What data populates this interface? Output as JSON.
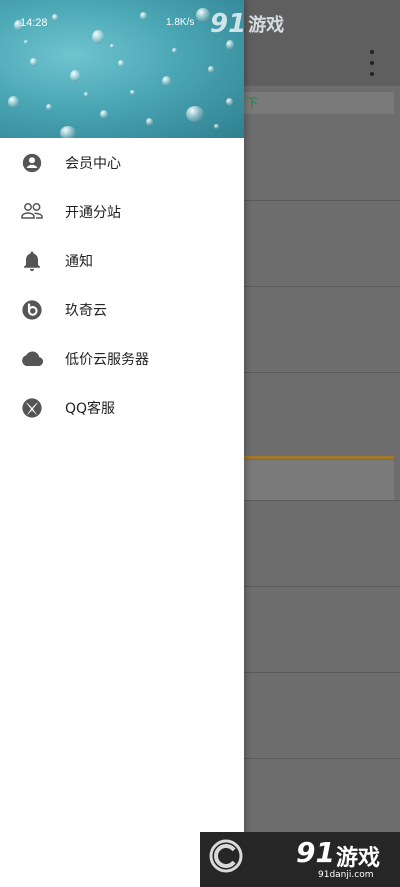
{
  "status_bar": {
    "time": "14:28",
    "net_speed": "1.8K/s"
  },
  "drawer": {
    "menu": [
      {
        "label": "会员中心",
        "icon": "account-circle-icon"
      },
      {
        "label": "开通分站",
        "icon": "people-outline-icon"
      },
      {
        "label": "通知",
        "icon": "bell-icon"
      },
      {
        "label": "玖奇云",
        "icon": "beats-logo-icon"
      },
      {
        "label": "低价云服务器",
        "icon": "cloud-icon"
      },
      {
        "label": "QQ客服",
        "icon": "xbox-logo-icon"
      }
    ]
  },
  "background_app": {
    "tab_fragment": "下"
  },
  "watermark": {
    "brand_number": "91",
    "brand_name": "游戏",
    "url": "91danji.com"
  },
  "colors": {
    "drawer_bg": "#ffffff",
    "scrim": "#6d6d6d",
    "icon": "#555555",
    "accent_line": "#a0792a",
    "tab_text": "#1f8a3a"
  }
}
